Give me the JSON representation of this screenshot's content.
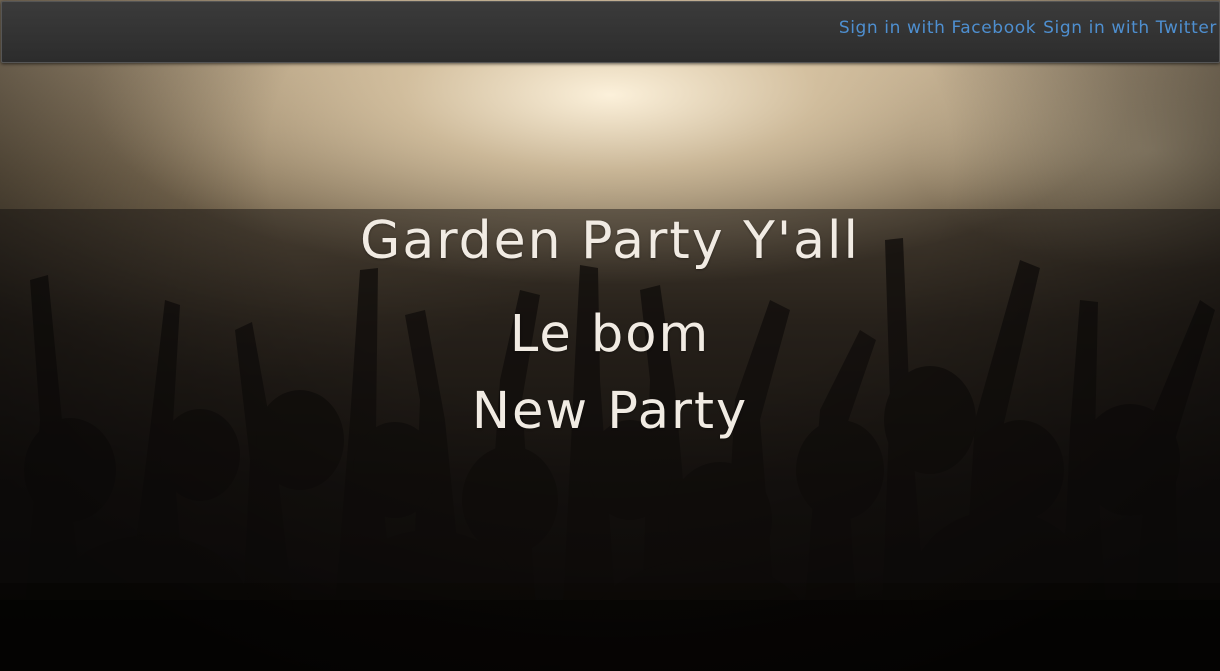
{
  "nav": {
    "links": [
      {
        "label": "Sign in with Facebook"
      },
      {
        "label": "Sign in with Twitter"
      }
    ]
  },
  "hero": {
    "background_description_icon": "concert-crowd-image",
    "title": "Garden Party Y'all",
    "lines": [
      "Le bom",
      "New Party"
    ]
  },
  "colors": {
    "nav_link": "#4e8fd0",
    "nav_bg": "#353535",
    "headline": "#f1ebe3"
  }
}
